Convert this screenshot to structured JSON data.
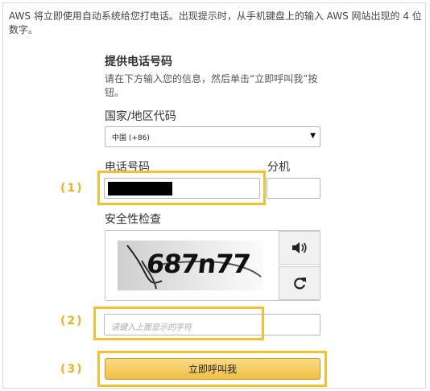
{
  "intro_text": "AWS 将立即使用自动系统给您打电话。出现提示时，从手机键盘上的输入 AWS 网站出现的 4 位数字。",
  "form": {
    "title": "提供电话号码",
    "subtitle": "请在下方输入您的信息，然后单击“立即呼叫我”按钮。",
    "country_label": "国家/地区代码",
    "country_value": "中国 (+86)",
    "phone_label": "电话号码",
    "extension_label": "分机",
    "phone_value_masked": true,
    "security_label": "安全性检查",
    "captcha_text": "687n77",
    "captcha_placeholder": "请键入上面显示的字符",
    "submit_label": "立即呼叫我"
  },
  "steps": {
    "step1": "(1)",
    "step2": "(2)",
    "step3": "(3)"
  },
  "icons": {
    "speaker": "speaker-icon",
    "refresh": "refresh-icon",
    "dropdown": "chevron-down-icon"
  },
  "colors": {
    "highlight": "#f2c12e",
    "step_text": "#f2b21e",
    "button_top": "#f9dc84",
    "button_bottom": "#f0bf45"
  }
}
